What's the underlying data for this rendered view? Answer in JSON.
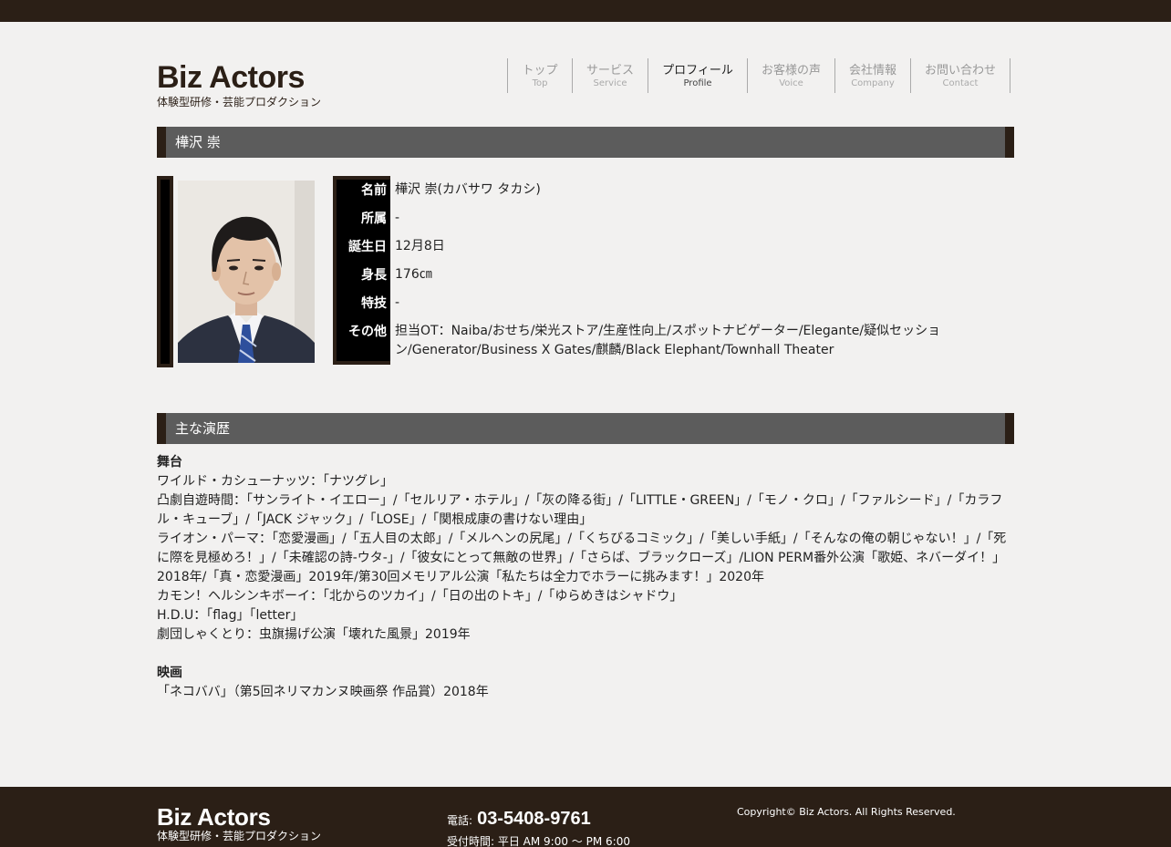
{
  "header": {
    "brand_title": "Biz Actors",
    "brand_subtitle": "体験型研修・芸能プロダクション"
  },
  "nav": {
    "items": [
      {
        "jp": "トップ",
        "en": "Top",
        "active": false
      },
      {
        "jp": "サービス",
        "en": "Service",
        "active": false
      },
      {
        "jp": "プロフィール",
        "en": "Profile",
        "active": true
      },
      {
        "jp": "お客様の声",
        "en": "Voice",
        "active": false
      },
      {
        "jp": "会社情報",
        "en": "Company",
        "active": false
      },
      {
        "jp": "お問い合わせ",
        "en": "Contact",
        "active": false
      }
    ]
  },
  "profile": {
    "section_title": "樺沢 崇",
    "rows": [
      {
        "label": "名前",
        "value": "樺沢 崇(カバサワ タカシ)"
      },
      {
        "label": "所属",
        "value": "-"
      },
      {
        "label": "誕生日",
        "value": "12月8日"
      },
      {
        "label": "身長",
        "value": "176㎝"
      },
      {
        "label": "特技",
        "value": "-"
      },
      {
        "label": "その他",
        "value": "担当OT：Naiba/おせち/栄光ストア/生産性向上/スポットナビゲーター/Elegante/疑似セッション/Generator/Business X Gates/麒麟/Black Elephant/Townhall Theater"
      }
    ]
  },
  "career": {
    "section_title": "主な演歴",
    "stage_heading": "舞台",
    "stage_lines": [
      "ワイルド・カシューナッツ：「ナツグレ」",
      "凸劇自遊時間：「サンライト・イエロー」/「セルリア・ホテル」/「灰の降る街」/「LITTLE・GREEN」/「モノ・クロ」/「ファルシード」/「カラフル・キューブ」/「JACK ジャック」/「LOSE」/「関根成康の書けない理由」",
      "ライオン・パーマ：「恋愛漫画」/「五人目の太郎」/「メルヘンの尻尾」/「くちびるコミック」/「美しい手紙」/「そんなの俺の朝じゃない！」/「死に際を見極めろ！」/「未確認の詩-ウタ-」/「彼女にとって無敵の世界」/「さらば、ブラックローズ」/LION PERM番外公演「歌姫、ネバーダイ！」2018年/「真・恋愛漫画」2019年/第30回メモリアル公演「私たちは全力でホラーに挑みます！」2020年",
      "カモン！ヘルシンキボーイ：「北からのツカイ」/「日の出のトキ」/「ゆらめきはシャドウ」",
      "H.D.U：「flag」「letter」",
      "劇団しゃくとり：虫旗揚げ公演「壊れた風景」2019年"
    ],
    "film_heading": "映画",
    "film_lines": [
      "「ネコババ」（第5回ネリマカンヌ映画祭 作品賞）2018年"
    ]
  },
  "footer": {
    "brand_title": "Biz Actors",
    "brand_subtitle": "体験型研修・芸能プロダクション",
    "phone_label": "電話:",
    "phone_number": "03-5408-9761",
    "hours": "受付時間: 平日 AM 9:00 〜 PM 6:00",
    "copyright": "Copyright© Biz Actors. All Rights Reserved."
  },
  "colors": {
    "dark_brown": "#2b1f16",
    "section_gray": "#5c5c5c",
    "background": "#f2f1f0"
  }
}
